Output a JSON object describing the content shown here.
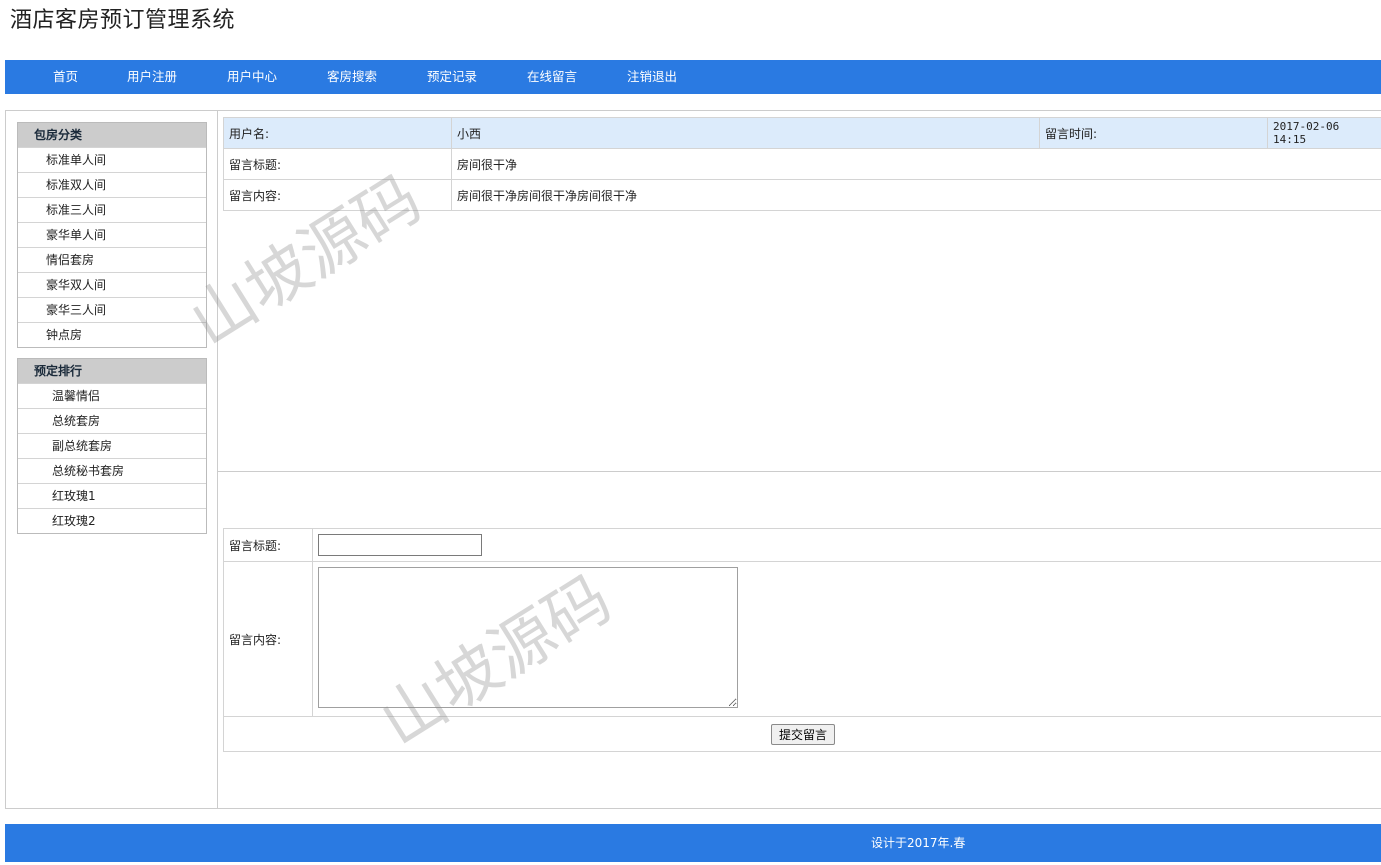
{
  "site": {
    "title": "酒店客房预订管理系统"
  },
  "nav": {
    "items": [
      {
        "label": "首页"
      },
      {
        "label": "用户注册"
      },
      {
        "label": "用户中心"
      },
      {
        "label": "客房搜索"
      },
      {
        "label": "预定记录"
      },
      {
        "label": "在线留言"
      },
      {
        "label": "注销退出"
      }
    ]
  },
  "sidebar": {
    "categories": {
      "title": "包房分类",
      "items": [
        "标准单人间",
        "标准双人间",
        "标准三人间",
        "豪华单人间",
        "情侣套房",
        "豪华双人间",
        "豪华三人间",
        "钟点房"
      ]
    },
    "ranking": {
      "title": "预定排行",
      "items": [
        "温馨情侣",
        "总统套房",
        "副总统套房",
        "总统秘书套房",
        "红玫瑰1",
        "红玫瑰2"
      ]
    }
  },
  "message": {
    "username_label": "用户名:",
    "username": "小西",
    "time_label": "留言时间:",
    "time": "2017-02-06 14:15",
    "title_label": "留言标题:",
    "title": "房间很干净",
    "content_label": "留言内容:",
    "content": "房间很干净房间很干净房间很干净"
  },
  "form": {
    "title_label": "留言标题:",
    "title_value": "",
    "content_label": "留言内容:",
    "content_value": "",
    "submit_label": "提交留言"
  },
  "footer": {
    "text": "设计于2017年.春"
  },
  "watermark": {
    "text": "山坡源码"
  },
  "colors": {
    "nav_bg": "#2a7ae2",
    "header_row_bg": "#dcebfb",
    "sidebar_head_bg": "#cccccc"
  }
}
